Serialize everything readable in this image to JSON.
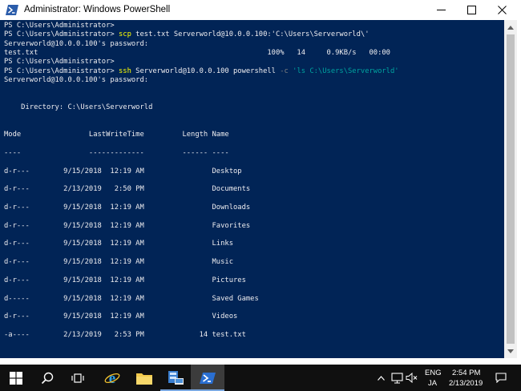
{
  "window": {
    "title": "Administrator: Windows PowerShell"
  },
  "console": {
    "lines": [
      {
        "segments": [
          {
            "t": "PS C:\\Users\\Administrator>",
            "s": "out"
          }
        ]
      },
      {
        "segments": [
          {
            "t": "PS C:\\Users\\Administrator> ",
            "s": "out"
          },
          {
            "t": "scp",
            "s": "cmd"
          },
          {
            "t": " test.txt Serverworld@10.0.0.100:",
            "s": "out"
          },
          {
            "t": "'C:\\Users\\Serverworld\\'",
            "s": "out"
          }
        ]
      },
      {
        "segments": [
          {
            "t": "Serverworld@10.0.0.100's password:",
            "s": "out"
          }
        ]
      },
      {
        "segments": [
          {
            "t": "test.txt                                                      100%   14     0.9KB/s   00:00",
            "s": "out"
          }
        ]
      },
      {
        "segments": [
          {
            "t": "PS C:\\Users\\Administrator>",
            "s": "out"
          }
        ]
      },
      {
        "segments": [
          {
            "t": "PS C:\\Users\\Administrator> ",
            "s": "out"
          },
          {
            "t": "ssh",
            "s": "cmd"
          },
          {
            "t": " Serverworld@10.0.0.100 powershell ",
            "s": "out"
          },
          {
            "t": "-c",
            "s": "param"
          },
          {
            "t": " ",
            "s": "out"
          },
          {
            "t": "'ls C:\\Users\\Serverworld'",
            "s": "str"
          }
        ]
      },
      {
        "segments": [
          {
            "t": "Serverworld@10.0.0.100's password:",
            "s": "out"
          }
        ]
      },
      {
        "segments": [
          {
            "t": "",
            "s": "out"
          }
        ]
      },
      {
        "segments": [
          {
            "t": "",
            "s": "out"
          }
        ]
      },
      {
        "segments": [
          {
            "t": "    Directory: C:\\Users\\Serverworld",
            "s": "out"
          }
        ]
      },
      {
        "segments": [
          {
            "t": "",
            "s": "out"
          }
        ]
      },
      {
        "segments": [
          {
            "t": "",
            "s": "out"
          }
        ]
      },
      {
        "segments": [
          {
            "t": "Mode                LastWriteTime         Length Name",
            "s": "out"
          }
        ]
      },
      {
        "segments": [
          {
            "t": "",
            "s": "out"
          }
        ]
      },
      {
        "segments": [
          {
            "t": "----                -------------         ------ ----",
            "s": "out"
          }
        ]
      },
      {
        "segments": [
          {
            "t": "",
            "s": "out"
          }
        ]
      },
      {
        "segments": [
          {
            "t": "d-r---        9/15/2018  12:19 AM                Desktop",
            "s": "out"
          }
        ]
      },
      {
        "segments": [
          {
            "t": "",
            "s": "out"
          }
        ]
      },
      {
        "segments": [
          {
            "t": "d-r---        2/13/2019   2:50 PM                Documents",
            "s": "out"
          }
        ]
      },
      {
        "segments": [
          {
            "t": "",
            "s": "out"
          }
        ]
      },
      {
        "segments": [
          {
            "t": "d-r---        9/15/2018  12:19 AM                Downloads",
            "s": "out"
          }
        ]
      },
      {
        "segments": [
          {
            "t": "",
            "s": "out"
          }
        ]
      },
      {
        "segments": [
          {
            "t": "d-r---        9/15/2018  12:19 AM                Favorites",
            "s": "out"
          }
        ]
      },
      {
        "segments": [
          {
            "t": "",
            "s": "out"
          }
        ]
      },
      {
        "segments": [
          {
            "t": "d-r---        9/15/2018  12:19 AM                Links",
            "s": "out"
          }
        ]
      },
      {
        "segments": [
          {
            "t": "",
            "s": "out"
          }
        ]
      },
      {
        "segments": [
          {
            "t": "d-r---        9/15/2018  12:19 AM                Music",
            "s": "out"
          }
        ]
      },
      {
        "segments": [
          {
            "t": "",
            "s": "out"
          }
        ]
      },
      {
        "segments": [
          {
            "t": "d-r---        9/15/2018  12:19 AM                Pictures",
            "s": "out"
          }
        ]
      },
      {
        "segments": [
          {
            "t": "",
            "s": "out"
          }
        ]
      },
      {
        "segments": [
          {
            "t": "d-----        9/15/2018  12:19 AM                Saved Games",
            "s": "out"
          }
        ]
      },
      {
        "segments": [
          {
            "t": "",
            "s": "out"
          }
        ]
      },
      {
        "segments": [
          {
            "t": "d-r---        9/15/2018  12:19 AM                Videos",
            "s": "out"
          }
        ]
      },
      {
        "segments": [
          {
            "t": "",
            "s": "out"
          }
        ]
      },
      {
        "segments": [
          {
            "t": "-a----        2/13/2019   2:53 PM             14 test.txt",
            "s": "out"
          }
        ]
      }
    ]
  },
  "taskbar": {
    "pinned": [
      {
        "name": "start-button",
        "icon": "windows-logo-icon"
      },
      {
        "name": "search-button",
        "icon": "search-icon"
      },
      {
        "name": "task-view-button",
        "icon": "task-view-icon"
      },
      {
        "name": "internet-explorer-button",
        "icon": "internet-explorer-icon"
      },
      {
        "name": "file-explorer-button",
        "icon": "folder-icon"
      },
      {
        "name": "server-manager-button",
        "icon": "server-manager-icon"
      },
      {
        "name": "powershell-button",
        "icon": "powershell-icon"
      }
    ],
    "tray": {
      "lang_top": "ENG",
      "lang_bottom": "JA",
      "time": "2:54 PM",
      "date": "2/13/2019"
    }
  },
  "colors": {
    "console_bg": "#012456",
    "console_fg": "#eeedf0",
    "command": "#ffff00",
    "parameter": "#808080",
    "string": "#00a4a0",
    "taskbar_bg": "#101010"
  }
}
